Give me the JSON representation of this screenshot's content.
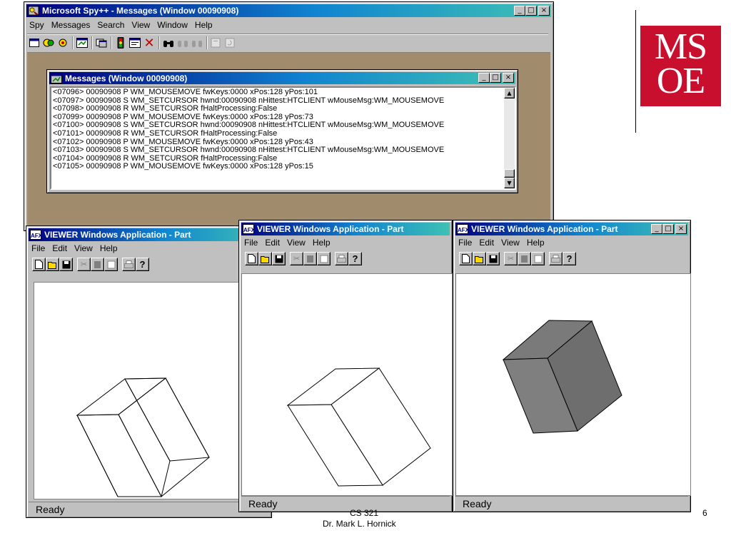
{
  "spy": {
    "title": "Microsoft Spy++ - Messages (Window 00090908)",
    "menu": [
      "Spy",
      "Messages",
      "Search",
      "View",
      "Window",
      "Help"
    ],
    "buttons": {
      "minimize": "_",
      "maximize": "□",
      "close": "×"
    }
  },
  "messages": {
    "title": "Messages (Window 00090908)",
    "lines": [
      "<07096> 00090908 P WM_MOUSEMOVE fwKeys:0000 xPos:128 yPos:101",
      "<07097> 00090908 S WM_SETCURSOR hwnd:00090908 nHittest:HTCLIENT wMouseMsg:WM_MOUSEMOVE",
      "<07098> 00090908 R WM_SETCURSOR fHaltProcessing:False",
      "<07099> 00090908 P WM_MOUSEMOVE fwKeys:0000 xPos:128 yPos:73",
      "<07100> 00090908 S WM_SETCURSOR hwnd:00090908 nHittest:HTCLIENT wMouseMsg:WM_MOUSEMOVE",
      "<07101> 00090908 R WM_SETCURSOR fHaltProcessing:False",
      "<07102> 00090908 P WM_MOUSEMOVE fwKeys:0000 xPos:128 yPos:43",
      "<07103> 00090908 S WM_SETCURSOR hwnd:00090908 nHittest:HTCLIENT wMouseMsg:WM_MOUSEMOVE",
      "<07104> 00090908 R WM_SETCURSOR fHaltProcessing:False",
      "<07105> 00090908 P WM_MOUSEMOVE fwKeys:0000 xPos:128 yPos:15"
    ]
  },
  "viewer": {
    "title": "VIEWER Windows Application - Part",
    "menu": [
      "File",
      "Edit",
      "View",
      "Help"
    ],
    "status": "Ready"
  },
  "logo": {
    "line1": "MS",
    "line2": "OE",
    "color": "#c8102e"
  },
  "footer": {
    "course": "CS 321",
    "author": "Dr. Mark L. Hornick",
    "page": "6"
  },
  "colors": {
    "desktop": "#a08c6c",
    "title_start": "#000080",
    "title_end": "#3fc1b4",
    "cube_fill": "#808080"
  }
}
